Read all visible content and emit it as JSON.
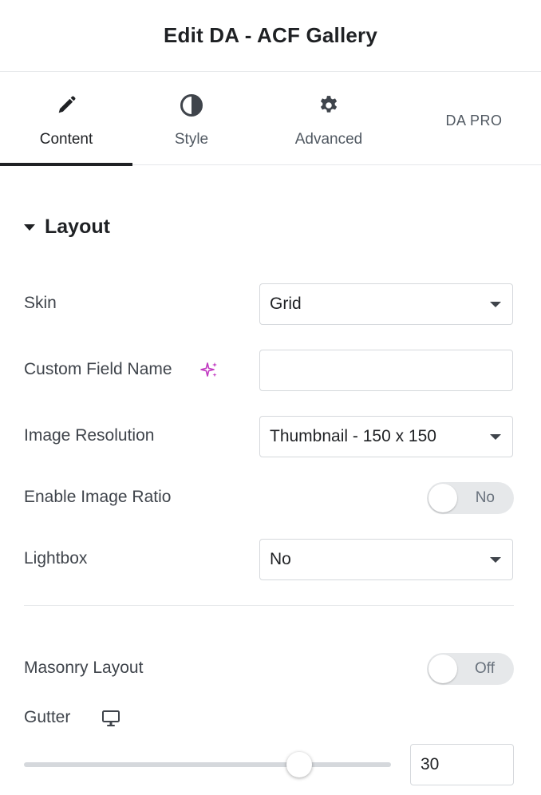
{
  "header": {
    "title": "Edit DA - ACF Gallery"
  },
  "tabs": [
    {
      "label": "Content",
      "icon": "pencil-icon",
      "active": true
    },
    {
      "label": "Style",
      "icon": "contrast-icon",
      "active": false
    },
    {
      "label": "Advanced",
      "icon": "gear-icon",
      "active": false
    },
    {
      "label": "DA PRO",
      "icon": "",
      "active": false
    }
  ],
  "section": {
    "title": "Layout",
    "expanded": true
  },
  "fields": {
    "skin": {
      "label": "Skin",
      "value": "Grid"
    },
    "custom_field_name": {
      "label": "Custom Field Name",
      "value": "",
      "ai_icon": "sparkle-icon",
      "ai_color": "#c036c0"
    },
    "image_resolution": {
      "label": "Image Resolution",
      "value": "Thumbnail - 150 x 150"
    },
    "enable_image_ratio": {
      "label": "Enable Image Ratio",
      "state": "No"
    },
    "lightbox": {
      "label": "Lightbox",
      "value": "No"
    },
    "masonry_layout": {
      "label": "Masonry Layout",
      "state": "Off"
    },
    "gutter": {
      "label": "Gutter",
      "device_icon": "desktop-icon",
      "value": "30",
      "min": 0,
      "max": 40
    }
  }
}
